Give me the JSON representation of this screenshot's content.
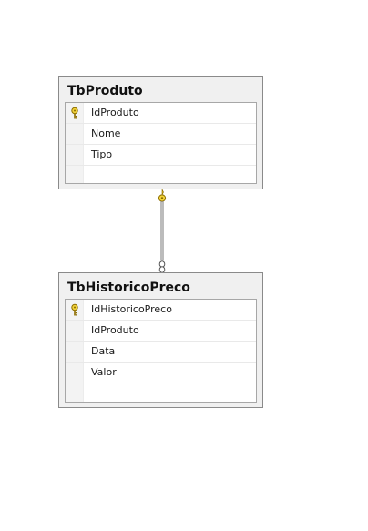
{
  "tables": [
    {
      "name": "TbProduto",
      "columns": [
        {
          "name": "IdProduto",
          "primary_key": true
        },
        {
          "name": "Nome",
          "primary_key": false
        },
        {
          "name": "Tipo",
          "primary_key": false
        }
      ]
    },
    {
      "name": "TbHistoricoPreco",
      "columns": [
        {
          "name": "IdHistoricoPreco",
          "primary_key": true
        },
        {
          "name": "IdProduto",
          "primary_key": false
        },
        {
          "name": "Data",
          "primary_key": false
        },
        {
          "name": "Valor",
          "primary_key": false
        }
      ]
    }
  ],
  "relationships": [
    {
      "from": "TbProduto",
      "to": "TbHistoricoPreco",
      "from_end": "one",
      "to_end": "many"
    }
  ],
  "colors": {
    "table_fill": "#f0f0f0",
    "table_border": "#8a8a8a",
    "grid_fill": "#ffffff",
    "key_icon": "#d9b81a",
    "relationship_line": "#7a7a7a"
  },
  "icons": {
    "primary_key": "key-icon",
    "relationship_one_end": "key-endpoint-icon",
    "relationship_many_end": "infinity-endpoint-icon"
  }
}
